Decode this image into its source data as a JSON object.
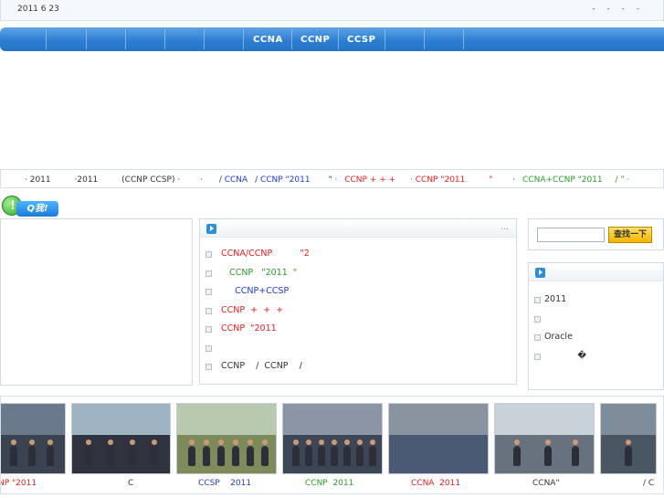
{
  "topbar": {
    "date": "2011 6 23",
    "links": "- - - -"
  },
  "nav": {
    "items": [
      "CCNA",
      "CCNP",
      "CCSP"
    ]
  },
  "ticker": [
    {
      "text": "· 2011",
      "color": "black"
    },
    {
      "text": "·2011",
      "color": "black"
    },
    {
      "text": "(CCNP CCSP) ·",
      "color": "black"
    },
    {
      "text": "·",
      "color": "black"
    },
    {
      "text": "/ CCNA",
      "color": "blue"
    },
    {
      "text": "/ CCNP \"2011",
      "color": "blue"
    },
    {
      "text": "\" ·",
      "color": "blue"
    },
    {
      "text": "CCNP + + +",
      "color": "red"
    },
    {
      "text": "· CCNP \"2011",
      "color": "red"
    },
    {
      "text": "\"",
      "color": "red"
    },
    {
      "text": "·",
      "color": "black"
    },
    {
      "text": "CCNA+CCNP \"2011",
      "color": "green"
    },
    {
      "text": "/ \" ·",
      "color": "green"
    }
  ],
  "qq": {
    "label": "Q我!"
  },
  "news": {
    "more": "...",
    "items": [
      {
        "text": "CCNA/CCNP          \"2",
        "color": "red"
      },
      {
        "text": "   CCNP   \"2011  \"",
        "color": "green"
      },
      {
        "text": "     CCNP+CCSP",
        "color": "blue"
      },
      {
        "text": "CCNP  +  +  +",
        "color": "red"
      },
      {
        "text": "CCNP  \"2011",
        "color": "red"
      },
      {
        "text": "",
        "color": "black"
      },
      {
        "text": "CCNP    /  CCNP    /",
        "color": "black"
      }
    ]
  },
  "search": {
    "button": "查找一下",
    "placeholder": ""
  },
  "side": {
    "items": [
      "2011",
      "",
      "Oracle",
      "            �"
    ]
  },
  "photos": [
    {
      "caption": "NP \"2011",
      "color": "red",
      "sky": "#6a7a8c",
      "floor": "#3b4250"
    },
    {
      "caption": "C",
      "color": "black",
      "sky": "#9fb3c2",
      "floor": "#2f3340"
    },
    {
      "caption": "CCSP    2011",
      "color": "blue",
      "sky": "#b8c9b0",
      "floor": "#7c8a5c"
    },
    {
      "caption": "CCNP  2011",
      "color": "green",
      "sky": "#8b95a6",
      "floor": "#3c4656"
    },
    {
      "caption": "CCNA  2011",
      "color": "red",
      "sky": "#8a93a0",
      "floor": "#4a5a74"
    },
    {
      "caption": "CCNA\"",
      "color": "black",
      "sky": "#c9d2d8",
      "floor": "#67727e"
    },
    {
      "caption": "/ C",
      "color": "black",
      "sky": "#7f8d9a",
      "floor": "#4b5663"
    }
  ]
}
